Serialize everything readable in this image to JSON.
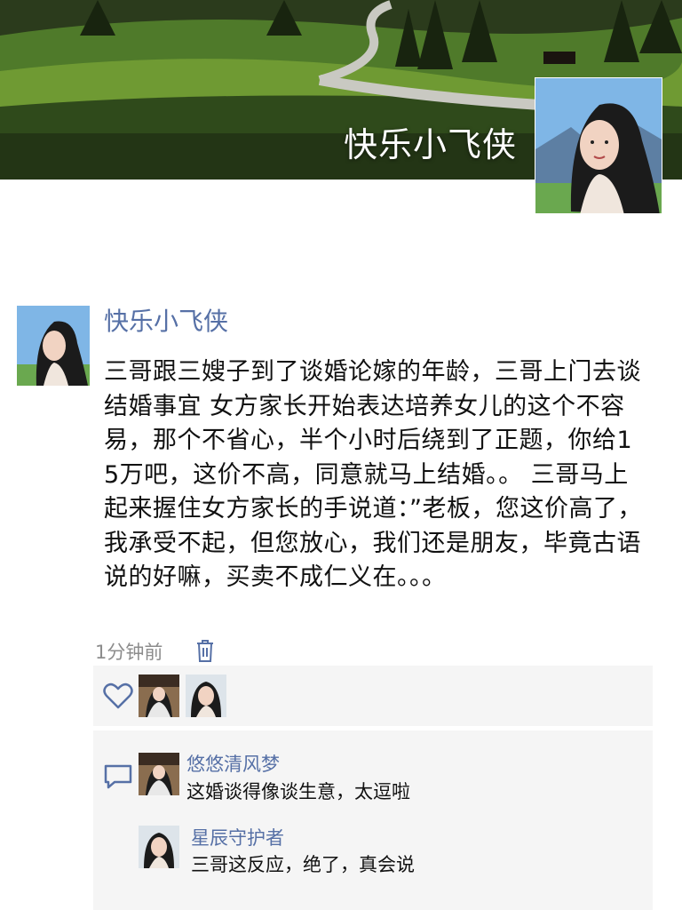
{
  "cover": {
    "username": "快乐小飞侠",
    "avatar_icon": "woman-portrait-avatar",
    "background_image": "green-hills-winding-road-landscape"
  },
  "post": {
    "author": "快乐小飞侠",
    "avatar_icon": "woman-portrait-avatar",
    "text": "三哥跟三嫂子到了谈婚论嫁的年龄，三哥上门去谈结婚事宜 女方家长开始表达培养女儿的这个不容易，那个不省心，半个小时后绕到了正题，你给15万吧，这价不高，同意就马上结婚。。 三哥马上起来握住女方家长的手说道：”老板，您这价高了，我承受不起，但您放心，我们还是朋友，毕竟古语说的好嘛，买卖不成仁义在。。。",
    "time": "1分钟前",
    "delete_icon": "trash-icon"
  },
  "likes": {
    "icon": "heart-icon",
    "avatars": [
      "girl-costume-avatar",
      "woman-portrait-avatar"
    ]
  },
  "comments": {
    "icon": "comment-icon",
    "items": [
      {
        "user": "悠悠清风梦",
        "text": "这婚谈得像谈生意，太逗啦",
        "avatar_icon": "girl-costume-avatar"
      },
      {
        "user": "星辰守护者",
        "text": "三哥这反应，绝了，真会说",
        "avatar_icon": "woman-portrait-avatar"
      }
    ]
  },
  "colors": {
    "link": "#5670a6",
    "panel_bg": "#f5f5f5",
    "meta_text": "#8c8c8c"
  }
}
